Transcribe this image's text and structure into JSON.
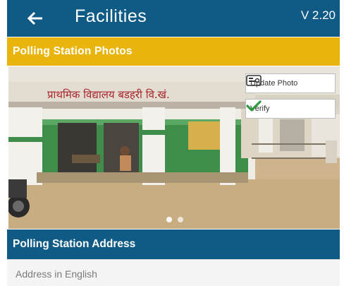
{
  "header": {
    "title": "Facilities",
    "version": "V 2.20"
  },
  "photos_section": {
    "title": "Polling Station Photos"
  },
  "photo_panel": {
    "sign_text": "प्राथमिक विद्यालय बडहरी वि.खं.",
    "update_label": "Update Photo",
    "verify_label": "Verify",
    "carousel_count": 2,
    "carousel_active": 0
  },
  "address_section": {
    "title": "Polling Station Address"
  },
  "address_field": {
    "placeholder": "Address in English"
  },
  "colors": {
    "primary": "#0f5b86",
    "accent": "#e9b40c",
    "verify": "#2e9a3d"
  },
  "icons": {
    "back": "arrow-left-icon",
    "update": "photo-update-icon",
    "verify": "check-icon"
  }
}
